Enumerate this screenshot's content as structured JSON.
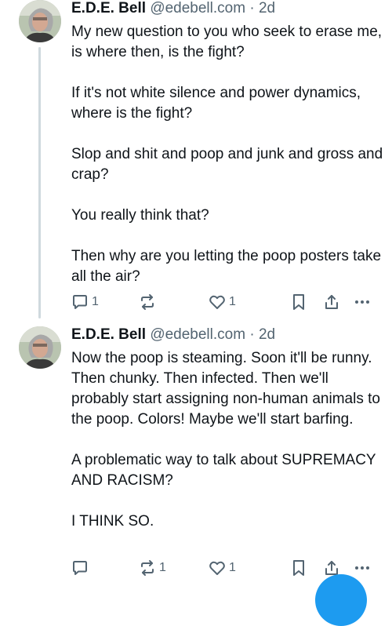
{
  "posts": [
    {
      "author": "E.D.E. Bell",
      "handle": "@edebell.com",
      "separator": "·",
      "time": "2d",
      "paragraphs": [
        "My new question to you who seek to erase me, is where then, is the fight?",
        "If it's not white silence and power dynamics, where is the fight?",
        "Slop and shit and poop and junk and gross and crap?",
        "You really think that?",
        "Then why are you letting the poop posters take all the air?"
      ],
      "actions": {
        "reply_count": "1",
        "repost_count": "",
        "like_count": "1"
      }
    },
    {
      "author": "E.D.E. Bell",
      "handle": "@edebell.com",
      "separator": "·",
      "time": "2d",
      "paragraphs": [
        "Now the poop is steaming. Soon it'll be runny. Then chunky. Then infected. Then we'll probably start assigning non-human animals to the poop. Colors! Maybe we'll start barfing.",
        "A problematic way to talk about SUPREMACY AND RACISM?",
        "I THINK SO."
      ],
      "actions": {
        "reply_count": "",
        "repost_count": "1",
        "like_count": "1"
      }
    }
  ],
  "icons": [
    "reply-icon",
    "repost-icon",
    "like-icon",
    "bookmark-icon",
    "share-icon",
    "more-icon",
    "compose-button"
  ],
  "colors": {
    "text": "#0f1419",
    "muted": "#536471",
    "accent": "#1d9bf0",
    "thread_line": "#cfd9de"
  }
}
